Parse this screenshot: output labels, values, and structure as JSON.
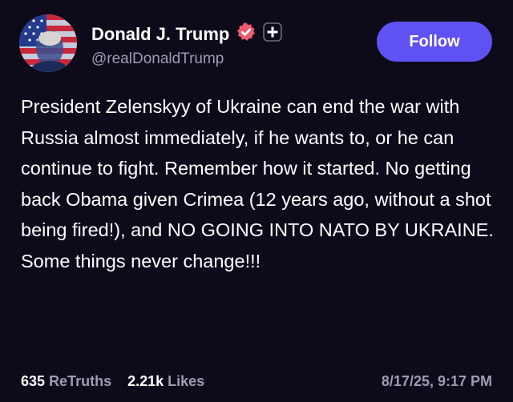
{
  "colors": {
    "background": "#0d0a1a",
    "accent": "#6052f2",
    "muted_text": "#a09ab3",
    "verified_badge": "#ee5b6e"
  },
  "author": {
    "display_name": "Donald J. Trump",
    "handle": "@realDonaldTrump",
    "avatar_icon": "flag-portrait-avatar",
    "verified_icon": "verified-badge-icon",
    "plus_icon": "plus-badge-icon"
  },
  "follow_button": {
    "label": "Follow"
  },
  "post": {
    "text": "President Zelenskyy of Ukraine can end the war with Russia almost immediately, if he wants to, or he can continue to fight. Remember how it started. No getting back Obama given Crimea (12 years ago, without a shot being fired!), and NO GOING INTO NATO BY UKRAINE. Some things never change!!!"
  },
  "stats": {
    "retruths_count": "635",
    "retruths_label": "ReTruths",
    "likes_count": "2.21k",
    "likes_label": "Likes"
  },
  "timestamp": "8/17/25, 9:17 PM"
}
